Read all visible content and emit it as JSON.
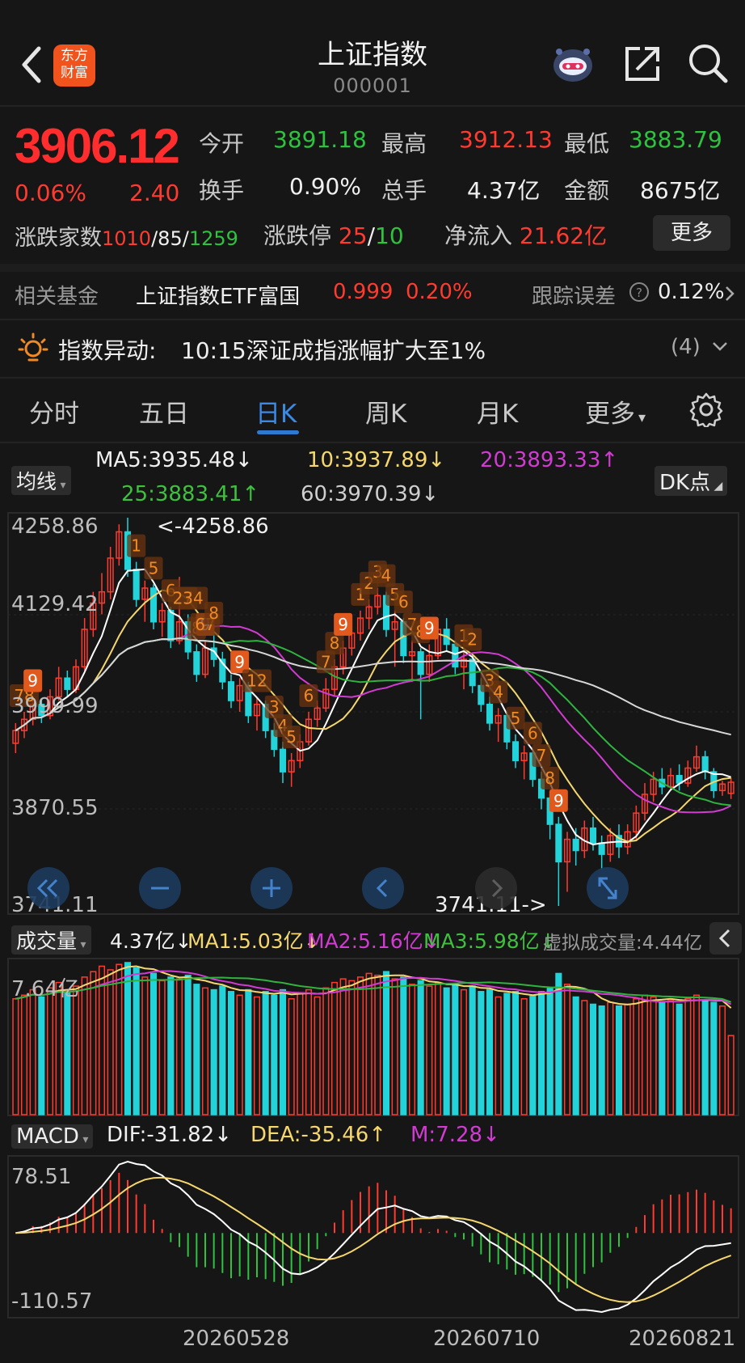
{
  "header": {
    "title": "上证指数",
    "code": "000001",
    "logo_lines": [
      "东方",
      "财富"
    ]
  },
  "quote": {
    "price": "3906.12",
    "change_pct": "0.06%",
    "change_abs": "2.40",
    "open_label": "今开",
    "open": "3891.18",
    "high_label": "最高",
    "high": "3912.13",
    "low_label": "最低",
    "low": "3883.79",
    "turnover_label": "换手",
    "turnover": "0.90%",
    "volume_label": "总手",
    "volume": "4.37亿",
    "amount_label": "金额",
    "amount": "8675亿",
    "breadth_label": "涨跌家数",
    "breadth_up": "1010",
    "breadth_sep1": "/",
    "breadth_flat": "85",
    "breadth_sep2": "/",
    "breadth_down": "1259",
    "limit_label": "涨跌停",
    "limit_up": "25",
    "limit_sep": "/",
    "limit_down": "10",
    "netflow_label": "净流入",
    "netflow": "21.62亿",
    "more_label": "更多"
  },
  "fund": {
    "label": "相关基金",
    "name": "上证指数ETF富国",
    "price": "0.999",
    "change": "0.20%",
    "tracking_label": "跟踪误差",
    "tracking_value": "0.12%"
  },
  "alert": {
    "label": "指数异动:",
    "text": "10:15深证成指涨幅扩大至1%",
    "count": "(4)"
  },
  "tabs": [
    "分时",
    "五日",
    "日K",
    "周K",
    "月K",
    "更多"
  ],
  "active_tab": "日K",
  "kline": {
    "selector": "均线",
    "dk_label": "DK点",
    "ma5": "MA5:3935.48↓",
    "ma10": "10:3937.89↓",
    "ma20": "20:3893.33↑",
    "ma25": "25:3883.41↑",
    "ma60": "60:3970.39↓",
    "axis": [
      "4258.86",
      "4129.42",
      "3999.99",
      "3870.55",
      "3741.11"
    ],
    "max_label": "<-4258.86",
    "min_label": "3741.11->",
    "td_labels": [
      "78",
      "9",
      "1",
      "5",
      "6",
      "7",
      "8",
      "9",
      "234",
      "67",
      "8",
      "9",
      "12",
      "3",
      "4",
      "5",
      "6",
      "7",
      "8",
      "9",
      "1",
      "2",
      "3",
      "4",
      "5",
      "6",
      "7",
      "8",
      "9",
      "1",
      "2",
      "3",
      "4",
      "5",
      "6",
      "7",
      "8",
      "9"
    ]
  },
  "volume": {
    "selector": "成交量",
    "current": "4.37亿↓",
    "ma1": "MA1:5.03亿↓",
    "ma2": "MA2:5.16亿↓",
    "ma3": "MA3:5.98亿↓",
    "virtual": "虚拟成交量:4.44亿",
    "axis": "7.64亿"
  },
  "macd": {
    "selector": "MACD",
    "dif": "DIF:-31.82↓",
    "dea": "DEA:-35.46↑",
    "m": "M:7.28↓",
    "axis_top": "78.51",
    "axis_bottom": "-110.57"
  },
  "dates": [
    "20260528",
    "20260710",
    "20260821"
  ],
  "colors": {
    "up": "#ff3b30",
    "down": "#22d3d9",
    "ma5": "#ffffff",
    "ma10": "#f5d76e",
    "ma20": "#d23bd2",
    "ma25": "#2fb33f",
    "ma60": "#d8d8d8"
  },
  "chart_data": {
    "type": "candlestick",
    "price_range": [
      3741.11,
      4258.86
    ],
    "volume_range": [
      0,
      8.4
    ],
    "candles": [
      {
        "o": 3958,
        "c": 3975,
        "h": 3985,
        "l": 3945,
        "v": 6.4
      },
      {
        "o": 3975,
        "c": 3990,
        "h": 4000,
        "l": 3965,
        "v": 6.6
      },
      {
        "o": 3990,
        "c": 4010,
        "h": 4020,
        "l": 3982,
        "v": 6.9
      },
      {
        "o": 4010,
        "c": 3995,
        "h": 4018,
        "l": 3985,
        "v": 6.5
      },
      {
        "o": 3995,
        "c": 4020,
        "h": 4030,
        "l": 3990,
        "v": 7.0
      },
      {
        "o": 4020,
        "c": 4045,
        "h": 4060,
        "l": 4015,
        "v": 7.3
      },
      {
        "o": 4045,
        "c": 4030,
        "h": 4055,
        "l": 4020,
        "v": 6.8
      },
      {
        "o": 4030,
        "c": 4060,
        "h": 4070,
        "l": 4025,
        "v": 7.1
      },
      {
        "o": 4060,
        "c": 4110,
        "h": 4125,
        "l": 4055,
        "v": 7.6
      },
      {
        "o": 4110,
        "c": 4145,
        "h": 4160,
        "l": 4100,
        "v": 7.9
      },
      {
        "o": 4145,
        "c": 4160,
        "h": 4185,
        "l": 4130,
        "v": 8.2
      },
      {
        "o": 4160,
        "c": 4205,
        "h": 4220,
        "l": 4150,
        "v": 8.0
      },
      {
        "o": 4205,
        "c": 4240,
        "h": 4250,
        "l": 4195,
        "v": 8.3
      },
      {
        "o": 4240,
        "c": 4190,
        "h": 4258.86,
        "l": 4180,
        "v": 8.4
      },
      {
        "o": 4190,
        "c": 4150,
        "h": 4200,
        "l": 4140,
        "v": 8.1
      },
      {
        "o": 4150,
        "c": 4165,
        "h": 4175,
        "l": 4120,
        "v": 7.6
      },
      {
        "o": 4165,
        "c": 4120,
        "h": 4170,
        "l": 4110,
        "v": 7.8
      },
      {
        "o": 4120,
        "c": 4135,
        "h": 4145,
        "l": 4100,
        "v": 7.4
      },
      {
        "o": 4135,
        "c": 4095,
        "h": 4140,
        "l": 4085,
        "v": 7.6
      },
      {
        "o": 4095,
        "c": 4120,
        "h": 4180,
        "l": 4090,
        "v": 7.5
      },
      {
        "o": 4120,
        "c": 4080,
        "h": 4130,
        "l": 4070,
        "v": 7.7
      },
      {
        "o": 4080,
        "c": 4050,
        "h": 4090,
        "l": 4040,
        "v": 7.2
      },
      {
        "o": 4050,
        "c": 4085,
        "h": 4095,
        "l": 4045,
        "v": 7.0
      },
      {
        "o": 4085,
        "c": 4070,
        "h": 4110,
        "l": 4060,
        "v": 6.9
      },
      {
        "o": 4070,
        "c": 4040,
        "h": 4080,
        "l": 4030,
        "v": 7.1
      },
      {
        "o": 4040,
        "c": 4015,
        "h": 4050,
        "l": 4005,
        "v": 6.8
      },
      {
        "o": 4015,
        "c": 4035,
        "h": 4045,
        "l": 4000,
        "v": 6.6
      },
      {
        "o": 4035,
        "c": 3995,
        "h": 4040,
        "l": 3985,
        "v": 6.9
      },
      {
        "o": 3995,
        "c": 4010,
        "h": 4020,
        "l": 3975,
        "v": 6.5
      },
      {
        "o": 4010,
        "c": 3975,
        "h": 4015,
        "l": 3965,
        "v": 6.8
      },
      {
        "o": 3975,
        "c": 3950,
        "h": 3985,
        "l": 3940,
        "v": 6.6
      },
      {
        "o": 3950,
        "c": 3920,
        "h": 3960,
        "l": 3905,
        "v": 6.9
      },
      {
        "o": 3920,
        "c": 3935,
        "h": 3945,
        "l": 3900,
        "v": 6.4
      },
      {
        "o": 3935,
        "c": 3960,
        "h": 3970,
        "l": 3925,
        "v": 6.7
      },
      {
        "o": 3960,
        "c": 3990,
        "h": 4000,
        "l": 3955,
        "v": 6.9
      },
      {
        "o": 3990,
        "c": 4005,
        "h": 4015,
        "l": 3980,
        "v": 6.5
      },
      {
        "o": 4005,
        "c": 4030,
        "h": 4045,
        "l": 4000,
        "v": 7.0
      },
      {
        "o": 4030,
        "c": 4060,
        "h": 4070,
        "l": 4020,
        "v": 7.3
      },
      {
        "o": 4060,
        "c": 4085,
        "h": 4095,
        "l": 4050,
        "v": 7.5
      },
      {
        "o": 4085,
        "c": 4105,
        "h": 4120,
        "l": 4075,
        "v": 7.4
      },
      {
        "o": 4105,
        "c": 4125,
        "h": 4135,
        "l": 4095,
        "v": 7.6
      },
      {
        "o": 4125,
        "c": 4140,
        "h": 4150,
        "l": 4110,
        "v": 7.8
      },
      {
        "o": 4140,
        "c": 4155,
        "h": 4165,
        "l": 4130,
        "v": 7.7
      },
      {
        "o": 4155,
        "c": 4110,
        "h": 4160,
        "l": 4100,
        "v": 7.9
      },
      {
        "o": 4110,
        "c": 4120,
        "h": 4135,
        "l": 4060,
        "v": 7.5
      },
      {
        "o": 4120,
        "c": 4075,
        "h": 4125,
        "l": 4065,
        "v": 7.6
      },
      {
        "o": 4075,
        "c": 4080,
        "h": 4095,
        "l": 4040,
        "v": 7.2
      },
      {
        "o": 4080,
        "c": 4050,
        "h": 4085,
        "l": 3990,
        "v": 7.4
      },
      {
        "o": 4050,
        "c": 4075,
        "h": 4090,
        "l": 4040,
        "v": 7.1
      },
      {
        "o": 4075,
        "c": 4110,
        "h": 4120,
        "l": 4070,
        "v": 7.3
      },
      {
        "o": 4110,
        "c": 4090,
        "h": 4125,
        "l": 4080,
        "v": 7.0
      },
      {
        "o": 4090,
        "c": 4060,
        "h": 4095,
        "l": 4050,
        "v": 7.2
      },
      {
        "o": 4060,
        "c": 4070,
        "h": 4080,
        "l": 4030,
        "v": 6.9
      },
      {
        "o": 4070,
        "c": 4035,
        "h": 4075,
        "l": 4025,
        "v": 7.1
      },
      {
        "o": 4035,
        "c": 4010,
        "h": 4045,
        "l": 4000,
        "v": 6.8
      },
      {
        "o": 4010,
        "c": 3985,
        "h": 4020,
        "l": 3975,
        "v": 6.9
      },
      {
        "o": 3985,
        "c": 3995,
        "h": 4005,
        "l": 3960,
        "v": 6.5
      },
      {
        "o": 3995,
        "c": 3960,
        "h": 4000,
        "l": 3950,
        "v": 6.7
      },
      {
        "o": 3960,
        "c": 3935,
        "h": 3970,
        "l": 3925,
        "v": 6.8
      },
      {
        "o": 3935,
        "c": 3945,
        "h": 3955,
        "l": 3910,
        "v": 6.4
      },
      {
        "o": 3945,
        "c": 3910,
        "h": 3950,
        "l": 3900,
        "v": 6.6
      },
      {
        "o": 3910,
        "c": 3885,
        "h": 3920,
        "l": 3870,
        "v": 6.8
      },
      {
        "o": 3885,
        "c": 3850,
        "h": 3890,
        "l": 3830,
        "v": 7.0
      },
      {
        "o": 3850,
        "c": 3800,
        "h": 3860,
        "l": 3741.11,
        "v": 7.8
      },
      {
        "o": 3800,
        "c": 3830,
        "h": 3840,
        "l": 3760,
        "v": 7.2
      },
      {
        "o": 3830,
        "c": 3815,
        "h": 3845,
        "l": 3795,
        "v": 6.5
      },
      {
        "o": 3815,
        "c": 3845,
        "h": 3855,
        "l": 3805,
        "v": 6.3
      },
      {
        "o": 3845,
        "c": 3825,
        "h": 3860,
        "l": 3815,
        "v": 6.1
      },
      {
        "o": 3825,
        "c": 3810,
        "h": 3835,
        "l": 3790,
        "v": 6.0
      },
      {
        "o": 3810,
        "c": 3835,
        "h": 3845,
        "l": 3800,
        "v": 6.2
      },
      {
        "o": 3835,
        "c": 3820,
        "h": 3850,
        "l": 3805,
        "v": 6.0
      },
      {
        "o": 3820,
        "c": 3840,
        "h": 3850,
        "l": 3810,
        "v": 6.1
      },
      {
        "o": 3840,
        "c": 3865,
        "h": 3875,
        "l": 3830,
        "v": 6.4
      },
      {
        "o": 3865,
        "c": 3890,
        "h": 3905,
        "l": 3855,
        "v": 6.6
      },
      {
        "o": 3890,
        "c": 3910,
        "h": 3920,
        "l": 3880,
        "v": 6.5
      },
      {
        "o": 3910,
        "c": 3900,
        "h": 3925,
        "l": 3890,
        "v": 6.2
      },
      {
        "o": 3900,
        "c": 3915,
        "h": 3925,
        "l": 3895,
        "v": 6.3
      },
      {
        "o": 3915,
        "c": 3905,
        "h": 3930,
        "l": 3895,
        "v": 6.1
      },
      {
        "o": 3905,
        "c": 3925,
        "h": 3935,
        "l": 3900,
        "v": 6.4
      },
      {
        "o": 3925,
        "c": 3940,
        "h": 3955,
        "l": 3920,
        "v": 6.6
      },
      {
        "o": 3940,
        "c": 3920,
        "h": 3948,
        "l": 3910,
        "v": 6.3
      },
      {
        "o": 3920,
        "c": 3895,
        "h": 3925,
        "l": 3885,
        "v": 6.2
      },
      {
        "o": 3895,
        "c": 3903.72,
        "h": 3908,
        "l": 3888,
        "v": 6.0
      },
      {
        "o": 3891.18,
        "c": 3906.12,
        "h": 3912.13,
        "l": 3883.79,
        "v": 4.37
      }
    ]
  }
}
